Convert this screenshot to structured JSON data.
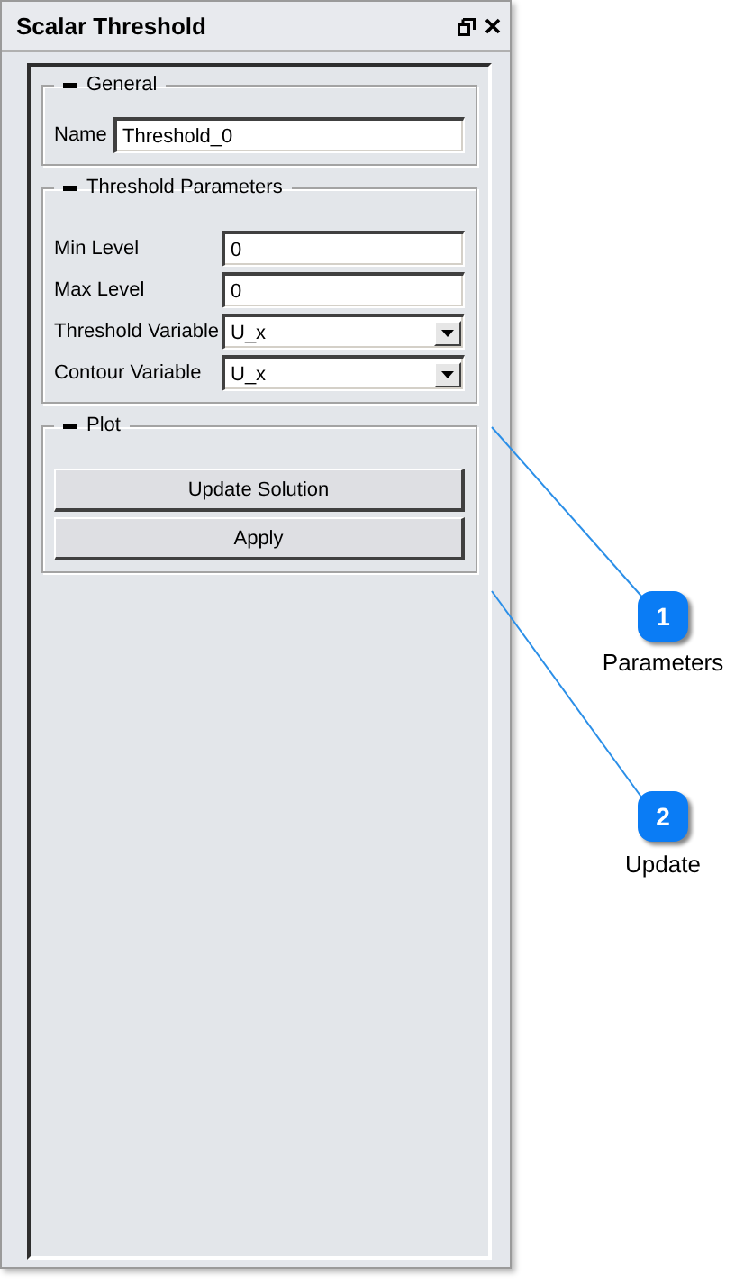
{
  "window": {
    "title": "Scalar Threshold"
  },
  "groups": [
    {
      "title": "General",
      "expanded": true,
      "rows": [
        {
          "kind": "text",
          "label": "Name",
          "value": "Threshold_0"
        }
      ]
    },
    {
      "title": "Threshold Parameters",
      "expanded": true,
      "rows": [
        {
          "kind": "number",
          "label": "Min Level",
          "value": "0"
        },
        {
          "kind": "number",
          "label": "Max Level",
          "value": "0"
        },
        {
          "kind": "choice",
          "label": "Threshold Variable",
          "value": "U_x"
        },
        {
          "kind": "choice",
          "label": "Contour Variable",
          "value": "U_x"
        }
      ]
    },
    {
      "title": "Plot",
      "expanded": true,
      "buttons": [
        "Update Solution",
        "Apply"
      ]
    }
  ],
  "callouts": [
    {
      "number": "1",
      "label": "Parameters"
    },
    {
      "number": "2",
      "label": "Update"
    }
  ]
}
